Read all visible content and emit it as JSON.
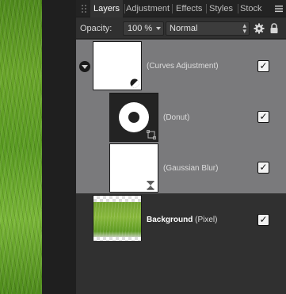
{
  "tabs": [
    {
      "label": "Layers",
      "active": true
    },
    {
      "label": "Adjustment",
      "active": false
    },
    {
      "label": "Effects",
      "active": false
    },
    {
      "label": "Styles",
      "active": false
    },
    {
      "label": "Stock",
      "active": false
    }
  ],
  "options": {
    "opacity_label": "Opacity:",
    "opacity_value": "100 %",
    "blend_mode": "Normal"
  },
  "layers": [
    {
      "name": "",
      "kind": "(Curves Adjustment)",
      "visible": true,
      "expanded": true
    },
    {
      "name": "",
      "kind": "(Donut)",
      "visible": true
    },
    {
      "name": "",
      "kind": "(Gaussian Blur)",
      "visible": true
    },
    {
      "name": "Background",
      "kind": "(Pixel)",
      "visible": true
    }
  ],
  "icons": {
    "menu": "hamburger-icon",
    "settings": "gear-icon",
    "lock": "lock-icon",
    "expand": "disclosure-triangle-icon"
  },
  "colors": {
    "group_selection": "#7a7a7c",
    "panel_bg": "#303030",
    "tab_bar": "#232323"
  }
}
